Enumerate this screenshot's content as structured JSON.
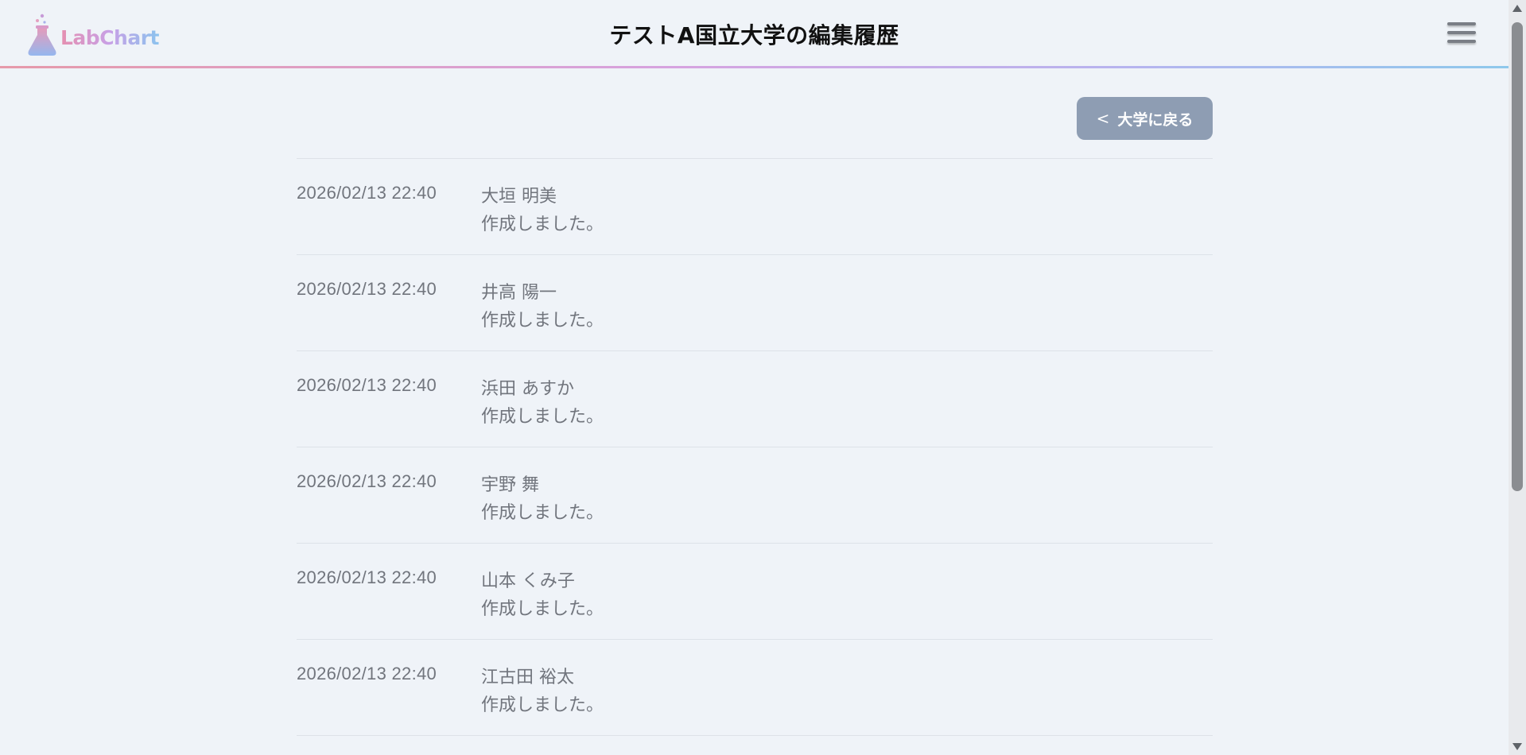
{
  "app": {
    "logo_text": "LabChart"
  },
  "header": {
    "title": "テストA国立大学の編集履歴",
    "menu_icon": "hamburger-menu-icon"
  },
  "back_button": {
    "chevron": "<",
    "label": "大学に戻る"
  },
  "colors": {
    "back_button_bg": "#8e9db3",
    "page_bg": "#eff3f8",
    "header_gradient": [
      "#e69aaa",
      "#d6a3e0",
      "#b6b4ef",
      "#8ec8ec"
    ]
  },
  "history": [
    {
      "time": "2026/02/13 22:40",
      "user": "大垣 明美",
      "action": "作成しました。"
    },
    {
      "time": "2026/02/13 22:40",
      "user": "井高 陽一",
      "action": "作成しました。"
    },
    {
      "time": "2026/02/13 22:40",
      "user": "浜田 あすか",
      "action": "作成しました。"
    },
    {
      "time": "2026/02/13 22:40",
      "user": "宇野 舞",
      "action": "作成しました。"
    },
    {
      "time": "2026/02/13 22:40",
      "user": "山本 くみ子",
      "action": "作成しました。"
    },
    {
      "time": "2026/02/13 22:40",
      "user": "江古田 裕太",
      "action": "作成しました。"
    }
  ]
}
